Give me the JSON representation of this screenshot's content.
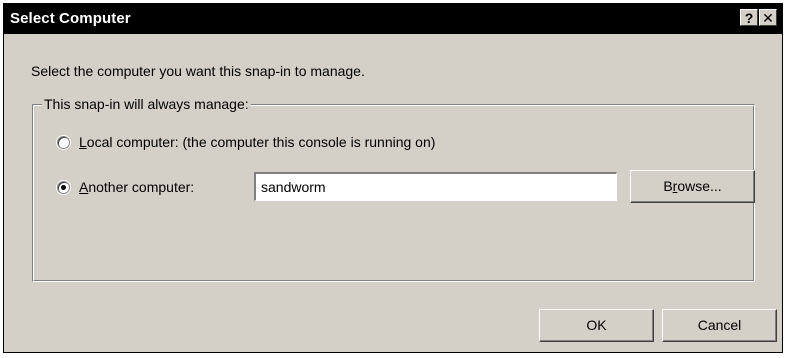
{
  "window": {
    "title": "Select Computer",
    "help_label": "?",
    "close_label": "✕"
  },
  "instruction": "Select the computer you want this snap-in to manage.",
  "group": {
    "legend": "This snap-in will always manage:",
    "local_option": {
      "accel": "L",
      "rest": "ocal computer:  (the computer this console is running on)",
      "selected": false
    },
    "another_option": {
      "accel": "A",
      "rest": "nother computer:",
      "selected": true
    },
    "computer_name": "sandworm",
    "browse": {
      "pre": "B",
      "accel": "r",
      "rest": "owse..."
    }
  },
  "buttons": {
    "ok": "OK",
    "cancel": "Cancel"
  }
}
